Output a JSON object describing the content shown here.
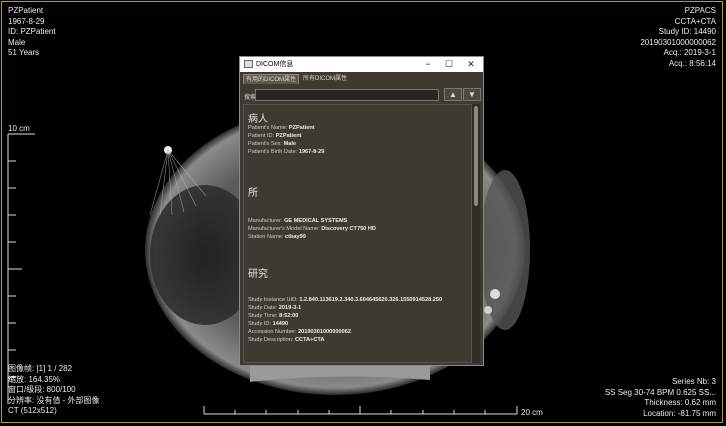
{
  "overlay": {
    "top_left": [
      "PZPatient",
      "1967-8-29",
      "ID: PZPatient",
      "Male",
      "51 Years"
    ],
    "top_right": [
      "PZPACS",
      "CCTA+CTA",
      "Study ID: 14490",
      "20190301000000062",
      "Acq.: 2019-3-1",
      "Acq.: 8:56:14"
    ],
    "bottom_left": [
      "图像帧:   [1] 1 / 282",
      "缩放: 164.35%",
      "窗口/级段: 800/100",
      "分辨率: 没有值 - 外部图像",
      "CT (512x512)"
    ],
    "bottom_right": [
      "Series Nb: 3",
      "SS Seg 30-74 BPM 0.625 SS...",
      "Thickness: 0.62 mm",
      "Location: -81.75 mm"
    ],
    "vertical_scale_label": "10 cm",
    "horizontal_scale_label": "20 cm"
  },
  "dialog": {
    "title": "DICOM信息",
    "minimize": "−",
    "maximize": "☐",
    "close": "✕",
    "tabs": [
      "有用的DICOM属性",
      "所有DICOM属性"
    ],
    "search_label": "搜索:",
    "search_value": "",
    "up_arrow": "▲",
    "down_arrow": "▼",
    "sections": [
      {
        "heading": "病人",
        "rows": [
          {
            "key": "Patient's Name:",
            "value": "PZPatient"
          },
          {
            "key": "Patient ID:",
            "value": "PZPatient"
          },
          {
            "key": "Patient's Sex:",
            "value": "Male"
          },
          {
            "key": "Patient's Birth Date:",
            "value": "1967-8-29"
          }
        ]
      },
      {
        "heading": "所",
        "rows": [
          {
            "key": "Manufacturer:",
            "value": "GE MEDICAL SYSTEMS"
          },
          {
            "key": "Manufacturer's Model Name:",
            "value": "Discovery CT750 HD"
          },
          {
            "key": "Station Name:",
            "value": "ctbay99"
          }
        ]
      },
      {
        "heading": "研究",
        "rows": [
          {
            "key": "Study Instance UID:",
            "value": "1.2.840.113619.2.340.3.604645620.326.1550914528.250"
          },
          {
            "key": "Study Date:",
            "value": "2019-3-1"
          },
          {
            "key": "Study Time:",
            "value": "8:52:00"
          },
          {
            "key": "Study ID:",
            "value": "14490"
          },
          {
            "key": "Accession Number:",
            "value": "20190301000000062"
          },
          {
            "key": "Study Description:",
            "value": "CCTA+CTA"
          }
        ]
      }
    ]
  }
}
